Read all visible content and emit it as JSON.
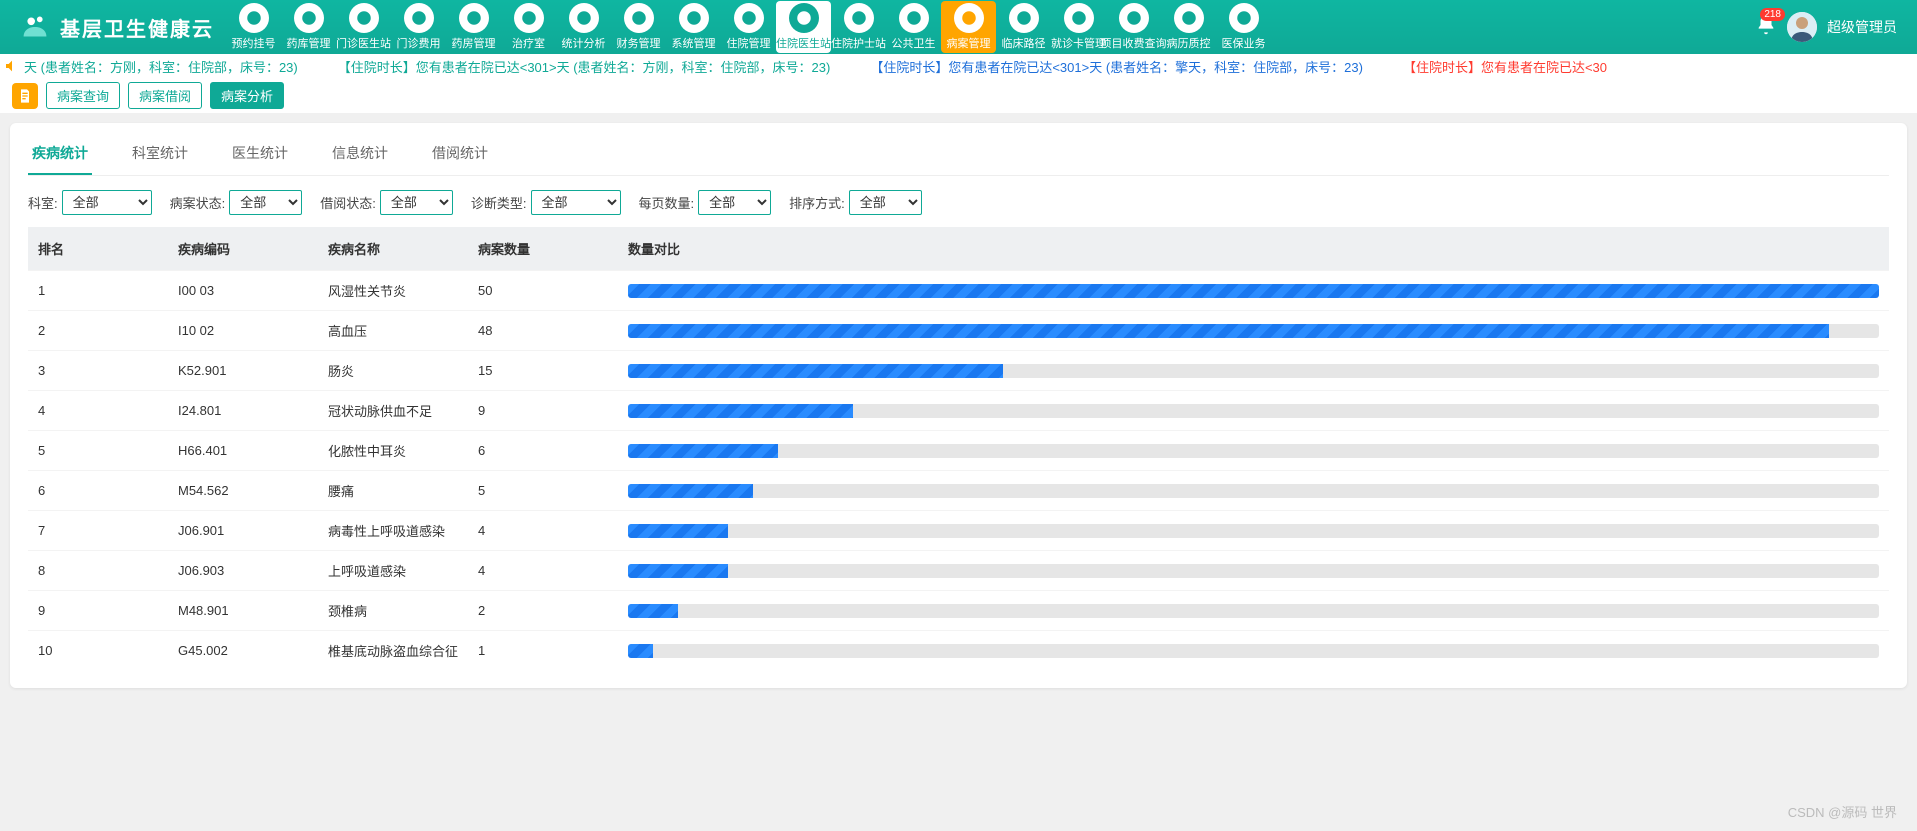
{
  "app_title": "基层卫生健康云",
  "user": {
    "name": "超级管理员",
    "badge": "218"
  },
  "nav": [
    {
      "label": "预约挂号"
    },
    {
      "label": "药库管理"
    },
    {
      "label": "门诊医生站"
    },
    {
      "label": "门诊费用"
    },
    {
      "label": "药房管理"
    },
    {
      "label": "治疗室"
    },
    {
      "label": "统计分析"
    },
    {
      "label": "财务管理"
    },
    {
      "label": "系统管理"
    },
    {
      "label": "住院管理"
    },
    {
      "label": "住院医生站",
      "kind": "hl"
    },
    {
      "label": "住院护士站"
    },
    {
      "label": "公共卫生"
    },
    {
      "label": "病案管理",
      "kind": "hl2"
    },
    {
      "label": "临床路径"
    },
    {
      "label": "就诊卡管理"
    },
    {
      "label": "项目收费查询"
    },
    {
      "label": "病历质控"
    },
    {
      "label": "医保业务"
    }
  ],
  "marquee": [
    {
      "text": "天 (患者姓名：方刚，科室：住院部，床号：23)",
      "cls": "mq-green"
    },
    {
      "text": "【住院时长】您有患者在院已达<301>天 (患者姓名：方刚，科室：住院部，床号：23)",
      "cls": "mq-green"
    },
    {
      "text": "【住院时长】您有患者在院已达<301>天 (患者姓名：擎天，科室：住院部，床号：23)",
      "cls": "mq-blue"
    },
    {
      "text": "【住院时长】您有患者在院已达<30",
      "cls": "mq-red"
    }
  ],
  "sub_tabs": [
    {
      "label": "病案查询"
    },
    {
      "label": "病案借阅"
    },
    {
      "label": "病案分析",
      "active": true
    }
  ],
  "inner_tabs": [
    {
      "label": "疾病统计",
      "active": true
    },
    {
      "label": "科室统计"
    },
    {
      "label": "医生统计"
    },
    {
      "label": "信息统计"
    },
    {
      "label": "借阅统计"
    }
  ],
  "filters": {
    "dept": {
      "label": "科室:",
      "value": "全部"
    },
    "case_state": {
      "label": "病案状态:",
      "value": "全部"
    },
    "borrow_state": {
      "label": "借阅状态:",
      "value": "全部"
    },
    "diag_type": {
      "label": "诊断类型:",
      "value": "全部"
    },
    "page_size": {
      "label": "每页数量:",
      "value": "全部"
    },
    "sort": {
      "label": "排序方式:",
      "value": "全部"
    }
  },
  "columns": {
    "rank": "排名",
    "code": "疾病编码",
    "name": "疾病名称",
    "count": "病案数量",
    "bar": "数量对比"
  },
  "rows": [
    {
      "rank": "1",
      "code": "I00 03",
      "name": "风湿性关节炎",
      "count": "50",
      "pct": 100
    },
    {
      "rank": "2",
      "code": "I10 02",
      "name": "高血压",
      "count": "48",
      "pct": 96
    },
    {
      "rank": "3",
      "code": "K52.901",
      "name": "肠炎",
      "count": "15",
      "pct": 30
    },
    {
      "rank": "4",
      "code": "I24.801",
      "name": "冠状动脉供血不足",
      "count": "9",
      "pct": 18
    },
    {
      "rank": "5",
      "code": "H66.401",
      "name": "化脓性中耳炎",
      "count": "6",
      "pct": 12
    },
    {
      "rank": "6",
      "code": "M54.562",
      "name": "腰痛",
      "count": "5",
      "pct": 10
    },
    {
      "rank": "7",
      "code": "J06.901",
      "name": "病毒性上呼吸道感染",
      "count": "4",
      "pct": 8
    },
    {
      "rank": "8",
      "code": "J06.903",
      "name": "上呼吸道感染",
      "count": "4",
      "pct": 8
    },
    {
      "rank": "9",
      "code": "M48.901",
      "name": "颈椎病",
      "count": "2",
      "pct": 4
    },
    {
      "rank": "10",
      "code": "G45.002",
      "name": "椎基底动脉盗血综合征",
      "count": "1",
      "pct": 2
    }
  ],
  "watermark": "CSDN @源码 世界",
  "chart_data": {
    "type": "bar",
    "title": "疾病统计 数量对比",
    "xlabel": "疾病名称",
    "ylabel": "病案数量",
    "ylim": [
      0,
      50
    ],
    "categories": [
      "风湿性关节炎",
      "高血压",
      "肠炎",
      "冠状动脉供血不足",
      "化脓性中耳炎",
      "腰痛",
      "病毒性上呼吸道感染",
      "上呼吸道感染",
      "颈椎病",
      "椎基底动脉盗血综合征"
    ],
    "values": [
      50,
      48,
      15,
      9,
      6,
      5,
      4,
      4,
      2,
      1
    ]
  }
}
